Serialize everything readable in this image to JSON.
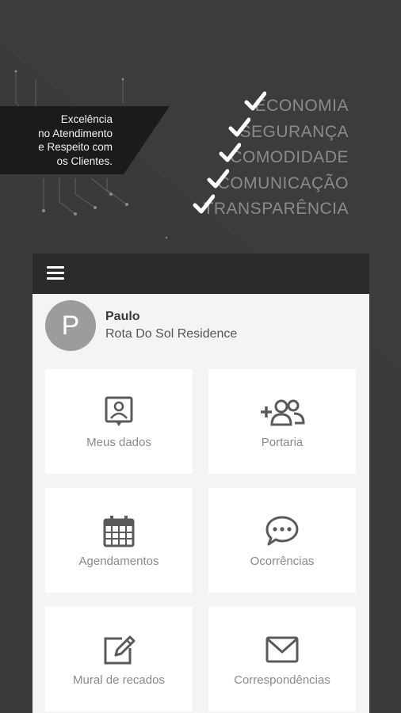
{
  "banner": {
    "lines": [
      "Excelência",
      "no Atendimento",
      "e Respeito com",
      "os Clientes."
    ]
  },
  "values": [
    "ECONOMIA",
    "SEGURANÇA",
    "COMODIDADE",
    "COMUNICAÇÃO",
    "TRANSPARÊNCIA"
  ],
  "user": {
    "initial": "P",
    "name": "Paulo",
    "condo": "Rota Do Sol Residence"
  },
  "menu": {
    "icon": "hamburger-menu-icon"
  },
  "tiles": [
    {
      "label": "Meus dados",
      "icon": "user-card-icon"
    },
    {
      "label": "Portaria",
      "icon": "add-users-icon"
    },
    {
      "label": "Agendamentos",
      "icon": "calendar-icon"
    },
    {
      "label": "Ocorrências",
      "icon": "chat-bubble-icon"
    },
    {
      "label": "Mural de recados",
      "icon": "edit-note-icon"
    },
    {
      "label": "Correspondências",
      "icon": "envelope-icon"
    }
  ],
  "colors": {
    "topbar": "#2a2a2a",
    "icon": "#5a5a5a",
    "avatar": "#9c9c9c"
  }
}
